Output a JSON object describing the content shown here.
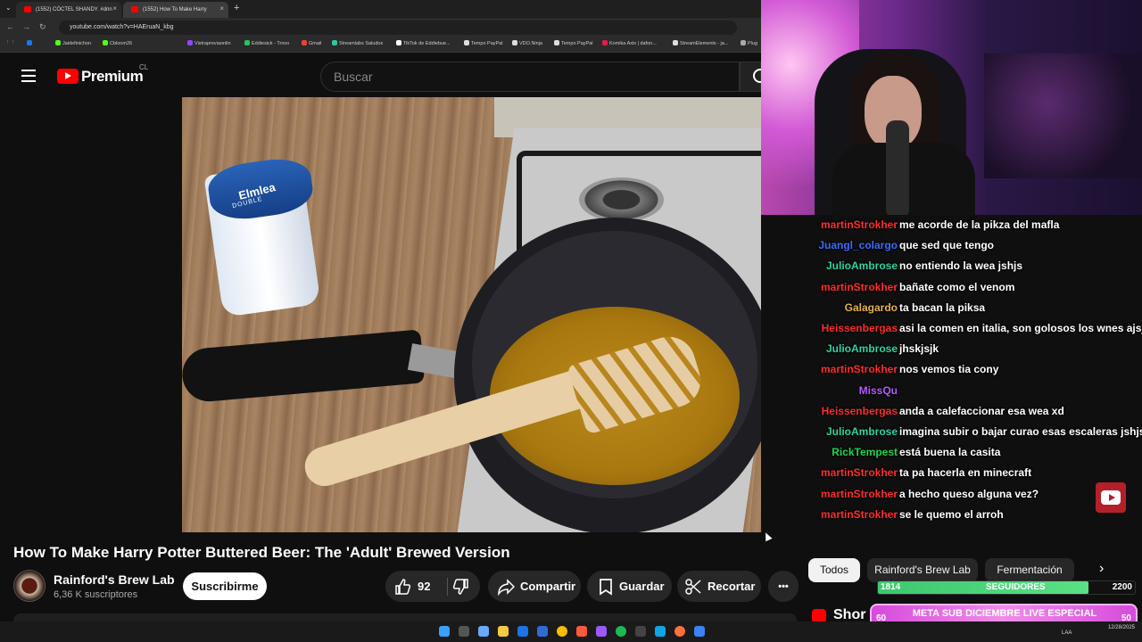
{
  "browser": {
    "tabs": [
      {
        "title": "(1552) CÓCTEL SHANDY. #drin"
      },
      {
        "title": "(1552) How To Make Harry"
      }
    ],
    "url": "youtube.com/watch?v=HAEruaN_kbg",
    "bookmarks": [
      "Jaidefinichon",
      "Cbloom26",
      "Vistrapreviaonlin",
      "Eddiesick - Trovo",
      "Gmail",
      "Streamlabs Saludos",
      "TikTok de Eddiebue...",
      "Tempo PayPal",
      "VDO.Ninja",
      "Tempo PayPal",
      "Komika Axis | dafon...",
      "StreamElements - ja...",
      "Plug"
    ]
  },
  "youtube": {
    "brand": "Premium",
    "region": "CL",
    "search_placeholder": "Buscar",
    "video_title": "How To Make Harry Potter Buttered Beer: The 'Adult' Brewed Version",
    "channel_name": "Rainford's Brew Lab",
    "subscribers": "6,36 K suscriptores",
    "subscribe_label": "Suscribirme",
    "like_count": "92",
    "share_label": "Compartir",
    "save_label": "Guardar",
    "clip_label": "Recortar",
    "more_label": "•••",
    "chips": [
      "Todos",
      "Rainford's Brew Lab",
      "Fermentación"
    ],
    "shorts_label": "Shor",
    "video_scene": {
      "cup_brand": "Elmlea",
      "cup_sub": "DOUBLE"
    }
  },
  "chat": [
    {
      "user": "martinStrokher",
      "color": "#ff2e2e",
      "text": "me acorde de la pikza del mafla"
    },
    {
      "user": "Juangl_colargo",
      "color": "#3b6cff",
      "text": "que sed que tengo"
    },
    {
      "user": "JulioAmbrose",
      "color": "#2bd6a5",
      "text": "no entiendo la wea jshjs"
    },
    {
      "user": "martinStrokher",
      "color": "#ff2e2e",
      "text": "bañate como el venom"
    },
    {
      "user": "Galagardo",
      "color": "#e8b04a",
      "text": "ta bacan la piksa"
    },
    {
      "user": "Heissenbergas",
      "color": "#ff2e2e",
      "text": "asi la comen en italia, son golosos los wnes ajsjj"
    },
    {
      "user": "JulioAmbrose",
      "color": "#2bd6a5",
      "text": "jhskjsjk"
    },
    {
      "user": "martinStrokher",
      "color": "#ff2e2e",
      "text": "nos vemos tia cony"
    },
    {
      "user": "MissQu",
      "color": "#b35cff",
      "text": ""
    },
    {
      "user": "Heissenbergas",
      "color": "#ff2e2e",
      "text": "anda a calefaccionar esa wea xd"
    },
    {
      "user": "JulioAmbrose",
      "color": "#2bd6a5",
      "text": "imagina subir o bajar curao esas escaleras jshjsj"
    },
    {
      "user": "RickTempest",
      "color": "#21d44f",
      "text": "está buena la casita"
    },
    {
      "user": "martinStrokher",
      "color": "#ff2e2e",
      "text": "ta pa hacerla en minecraft"
    },
    {
      "user": "martinStrokher",
      "color": "#ff2e2e",
      "text": "a hecho queso alguna vez?"
    },
    {
      "user": "martinStrokher",
      "color": "#ff2e2e",
      "text": "se le quemo el arroh"
    }
  ],
  "overlay": {
    "followers_current": "1814",
    "followers_label": "SEGUIDORES",
    "followers_goal": "2200",
    "followers_progress": 0.82,
    "meta_left": "60",
    "meta_text": "META SUB DICIEMBRE LIVE ESPECIAL",
    "meta_right": "50"
  },
  "taskbar": {
    "clock_line1": "",
    "clock_line2": "12/28/2025",
    "lang": "LAA"
  },
  "colors": {
    "accent": "#ff0000",
    "background": "#0f0f0f"
  }
}
